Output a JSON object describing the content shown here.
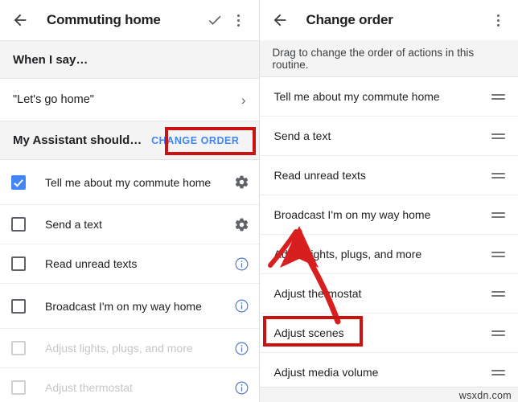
{
  "left_screen": {
    "appbar": {
      "back_icon": "back-arrow-icon",
      "title": "Commuting home",
      "confirm_icon": "check-icon",
      "overflow_icon": "kebab-menu-icon"
    },
    "when_section": {
      "header": "When I say…",
      "phrase": "\"Let's go home\"",
      "chevron": "›"
    },
    "should_section": {
      "header": "My Assistant should…",
      "change_order_label": "CHANGE ORDER"
    },
    "actions": [
      {
        "label": "Tell me about my commute home",
        "checked": true,
        "enabled": true,
        "trailing_icon": "gear-icon"
      },
      {
        "label": "Send a text",
        "checked": false,
        "enabled": true,
        "trailing_icon": "gear-icon"
      },
      {
        "label": "Read unread texts",
        "checked": false,
        "enabled": true,
        "trailing_icon": "info-icon"
      },
      {
        "label": "Broadcast I'm on my way home",
        "checked": false,
        "enabled": true,
        "trailing_icon": "info-icon"
      },
      {
        "label": "Adjust lights, plugs, and more",
        "checked": false,
        "enabled": false,
        "trailing_icon": "info-icon"
      },
      {
        "label": "Adjust thermostat",
        "checked": false,
        "enabled": false,
        "trailing_icon": "info-icon"
      }
    ]
  },
  "right_screen": {
    "appbar": {
      "back_icon": "back-arrow-icon",
      "title": "Change order",
      "overflow_icon": "kebab-menu-icon"
    },
    "hint": "Drag to change the order of actions in this routine.",
    "order_items": [
      {
        "label": "Tell me about my commute home"
      },
      {
        "label": "Send a text"
      },
      {
        "label": "Read unread texts"
      },
      {
        "label": "Broadcast I'm on my way home"
      },
      {
        "label": "Adjust lights, plugs, and more"
      },
      {
        "label": "Adjust thermostat"
      },
      {
        "label": "Adjust scenes"
      },
      {
        "label": "Adjust media volume"
      }
    ],
    "handle_icon": "drag-handle-icon"
  },
  "annotations": {
    "highlight_color": "#cc1111",
    "arrow_color": "#d81f1f",
    "highlight_change_order": "CHANGE ORDER",
    "highlight_adjust_scenes": "Adjust scenes",
    "arrow_description": "curved-arrow-icon"
  },
  "watermark": "wsxdn.com",
  "colors": {
    "accent_blue": "#4285f4",
    "band_gray": "#f4f4f4",
    "text_primary": "#202124",
    "text_disabled": "#c6c6c6",
    "icon_gray": "#5f6368"
  }
}
